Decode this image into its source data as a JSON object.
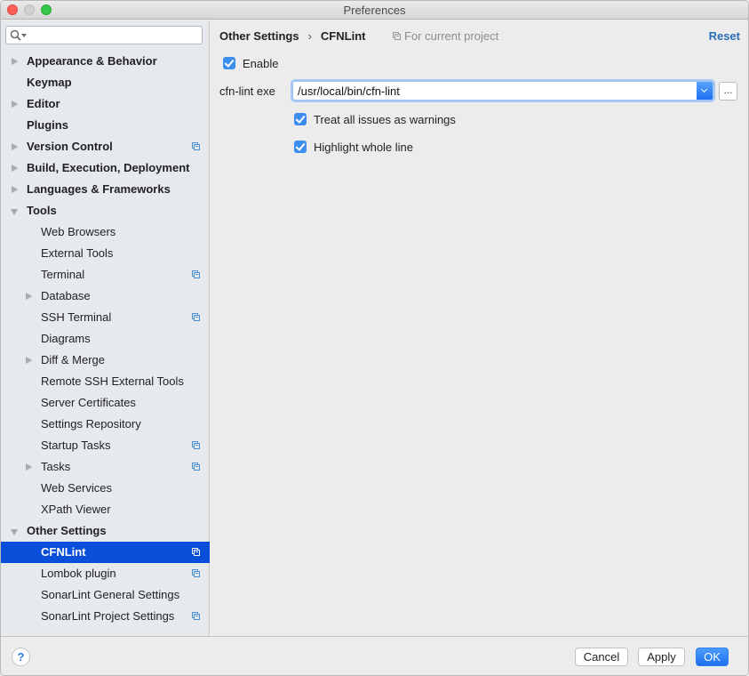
{
  "window": {
    "title": "Preferences"
  },
  "search": {
    "placeholder": "",
    "value": ""
  },
  "sidebar": {
    "items": [
      {
        "label": "Appearance & Behavior",
        "level": 0,
        "arrow": "right",
        "project": false
      },
      {
        "label": "Keymap",
        "level": 0,
        "arrow": "none",
        "project": false
      },
      {
        "label": "Editor",
        "level": 0,
        "arrow": "right",
        "project": false
      },
      {
        "label": "Plugins",
        "level": 0,
        "arrow": "none",
        "project": false
      },
      {
        "label": "Version Control",
        "level": 0,
        "arrow": "right",
        "project": true
      },
      {
        "label": "Build, Execution, Deployment",
        "level": 0,
        "arrow": "right",
        "project": false
      },
      {
        "label": "Languages & Frameworks",
        "level": 0,
        "arrow": "right",
        "project": false
      },
      {
        "label": "Tools",
        "level": 0,
        "arrow": "down",
        "project": false
      },
      {
        "label": "Web Browsers",
        "level": 1,
        "arrow": "none",
        "project": false
      },
      {
        "label": "External Tools",
        "level": 1,
        "arrow": "none",
        "project": false
      },
      {
        "label": "Terminal",
        "level": 1,
        "arrow": "none",
        "project": true
      },
      {
        "label": "Database",
        "level": 1,
        "arrow": "right",
        "project": false
      },
      {
        "label": "SSH Terminal",
        "level": 1,
        "arrow": "none",
        "project": true
      },
      {
        "label": "Diagrams",
        "level": 1,
        "arrow": "none",
        "project": false
      },
      {
        "label": "Diff & Merge",
        "level": 1,
        "arrow": "right",
        "project": false
      },
      {
        "label": "Remote SSH External Tools",
        "level": 1,
        "arrow": "none",
        "project": false
      },
      {
        "label": "Server Certificates",
        "level": 1,
        "arrow": "none",
        "project": false
      },
      {
        "label": "Settings Repository",
        "level": 1,
        "arrow": "none",
        "project": false
      },
      {
        "label": "Startup Tasks",
        "level": 1,
        "arrow": "none",
        "project": true
      },
      {
        "label": "Tasks",
        "level": 1,
        "arrow": "right",
        "project": true
      },
      {
        "label": "Web Services",
        "level": 1,
        "arrow": "none",
        "project": false
      },
      {
        "label": "XPath Viewer",
        "level": 1,
        "arrow": "none",
        "project": false
      },
      {
        "label": "Other Settings",
        "level": 0,
        "arrow": "down",
        "project": false
      },
      {
        "label": "CFNLint",
        "level": 1,
        "arrow": "none",
        "project": true,
        "selected": true
      },
      {
        "label": "Lombok plugin",
        "level": 1,
        "arrow": "none",
        "project": true
      },
      {
        "label": "SonarLint General Settings",
        "level": 1,
        "arrow": "none",
        "project": false
      },
      {
        "label": "SonarLint Project Settings",
        "level": 1,
        "arrow": "none",
        "project": true
      }
    ]
  },
  "content": {
    "breadcrumb": [
      "Other Settings",
      "CFNLint"
    ],
    "breadcrumb_separator": "›",
    "scope_label": "For current project",
    "reset_label": "Reset",
    "enable": {
      "label": "Enable",
      "checked": true
    },
    "exe_field": {
      "label": "cfn-lint exe",
      "value": "/usr/local/bin/cfn-lint"
    },
    "browse_label": "...",
    "options": [
      {
        "label": "Treat all issues as warnings",
        "checked": true
      },
      {
        "label": "Highlight whole line",
        "checked": true
      }
    ]
  },
  "footer": {
    "help_label": "?",
    "cancel_label": "Cancel",
    "apply_label": "Apply",
    "ok_label": "OK"
  }
}
